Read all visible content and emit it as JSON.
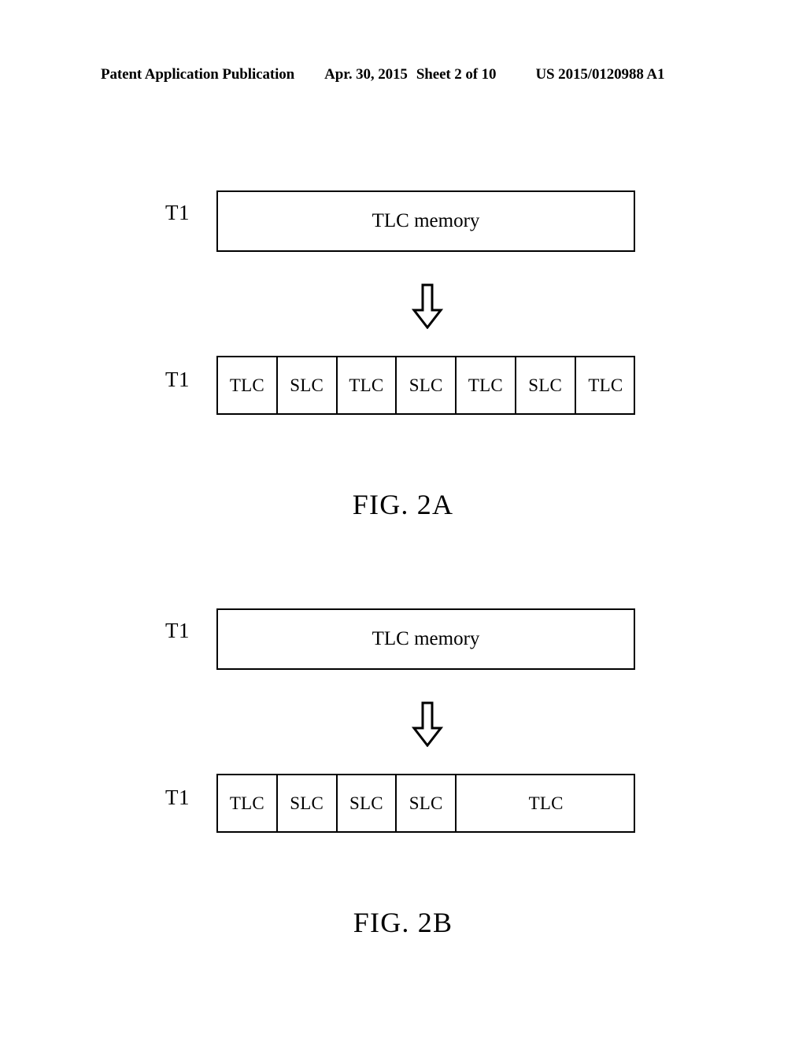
{
  "header": {
    "publication": "Patent Application Publication",
    "date": "Apr. 30, 2015",
    "sheet": "Sheet 2 of 10",
    "patent_number": "US 2015/0120988 A1"
  },
  "figures": [
    {
      "id": "2A",
      "caption": "FIG. 2A",
      "before": {
        "label": "T1",
        "block_text": "TLC memory"
      },
      "transform_icon": "down-arrow-icon",
      "after": {
        "label": "T1",
        "cells": [
          {
            "text": "TLC",
            "span": 1
          },
          {
            "text": "SLC",
            "span": 1
          },
          {
            "text": "TLC",
            "span": 1
          },
          {
            "text": "SLC",
            "span": 1
          },
          {
            "text": "TLC",
            "span": 1
          },
          {
            "text": "SLC",
            "span": 1
          },
          {
            "text": "TLC",
            "span": 1
          }
        ]
      }
    },
    {
      "id": "2B",
      "caption": "FIG. 2B",
      "before": {
        "label": "T1",
        "block_text": "TLC memory"
      },
      "transform_icon": "down-arrow-icon",
      "after": {
        "label": "T1",
        "cells": [
          {
            "text": "TLC",
            "span": 1
          },
          {
            "text": "SLC",
            "span": 1
          },
          {
            "text": "SLC",
            "span": 1
          },
          {
            "text": "SLC",
            "span": 1
          },
          {
            "text": "TLC",
            "span": 3
          }
        ]
      }
    }
  ],
  "colors": {
    "ink": "#000000",
    "paper": "#ffffff"
  }
}
